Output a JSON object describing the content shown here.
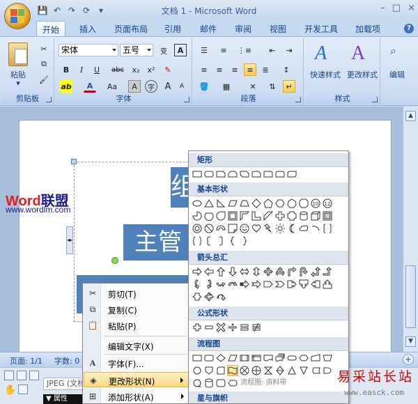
{
  "window": {
    "title": "文档 1 - Microsoft Word",
    "minimize": "–",
    "maximize": "□",
    "close": "×"
  },
  "tabs": [
    "开始",
    "插入",
    "页面布局",
    "引用",
    "邮件",
    "审阅",
    "视图",
    "开发工具",
    "加载项"
  ],
  "ribbon": {
    "clipboard": {
      "paste_label": "粘贴",
      "group_label": "剪贴板"
    },
    "font": {
      "font_name": "宋体",
      "font_size": "五号",
      "group_label": "字体",
      "bold": "B",
      "italic": "I",
      "underline": "U",
      "strike": "abc",
      "subscript": "x₂",
      "superscript": "x²",
      "clear_format": "A",
      "text_effect": "A",
      "font_color": "A",
      "case": "Aa",
      "grow": "A",
      "shrink": "A"
    },
    "paragraph": {
      "group_label": "段落"
    },
    "styles": {
      "quick_styles": "快速样式",
      "change_styles": "更改样式",
      "group_label": "样式"
    },
    "editing": {
      "label": "编辑"
    }
  },
  "document": {
    "node1_text": "组",
    "node2_text": "主管"
  },
  "branding": {
    "logo_word": "Word",
    "logo_cn": "联盟",
    "logo_url": "www.wordlm.com"
  },
  "status": {
    "page": "页面: 1/1",
    "words": "字数: 0"
  },
  "bottom": {
    "jpeg_text": "JPEG (文档",
    "attr_text": "▼ 属性"
  },
  "context_menu": {
    "items": [
      {
        "label": "剪切(T)",
        "icon": "scissors-icon"
      },
      {
        "label": "复制(C)",
        "icon": "copy-icon"
      },
      {
        "label": "粘贴(P)",
        "icon": "paste-icon"
      },
      {
        "label": "编辑文字(X)",
        "icon": ""
      },
      {
        "label": "字体(F)...",
        "icon": "font-icon"
      },
      {
        "label": "更改形状(N)",
        "icon": "shape-icon",
        "highlighted": true
      },
      {
        "label": "添加形状(A)",
        "icon": "add-shape-icon"
      }
    ]
  },
  "shapes_menu": {
    "sections": [
      "矩形",
      "基本形状",
      "箭头总汇",
      "公式形状",
      "流程图",
      "星与旗帜"
    ],
    "hover_tooltip": "流程图: 资料带"
  },
  "watermark": {
    "text": "易采站长站",
    "url": "www.easck.com"
  },
  "colors": {
    "accent": "#4f81bd",
    "ribbon_bg": "#d0def2",
    "highlight": "#fbd97b",
    "logo_red": "#e02020",
    "logo_blue": "#1a1a8c"
  }
}
